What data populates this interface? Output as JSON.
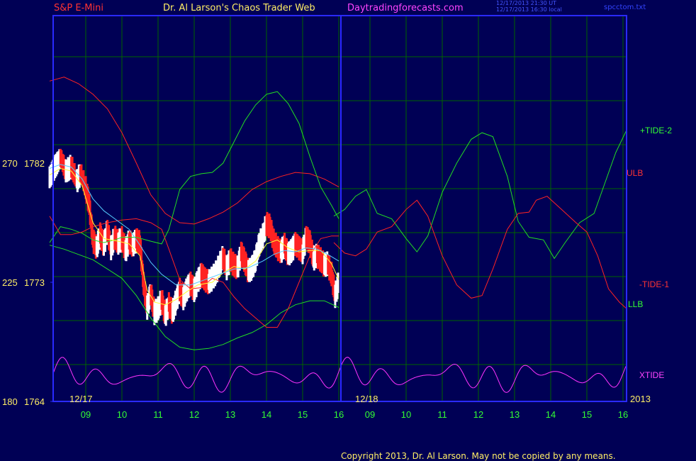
{
  "header": {
    "instrument": "S&P E-Mini",
    "title": "Dr. Al Larson's Chaos Trader Web",
    "site": "Daytradingforecasts.com",
    "stamp_line1": "12/17/2013 21:30 UT",
    "stamp_line2": "12/17/2013 16:30 local",
    "file": "spcctom.txt"
  },
  "footer": {
    "copyright": "Copyright 2013, Dr. Al Larson. May not be copied by any means."
  },
  "colors": {
    "background": "#000055",
    "frame": "#2a2aff",
    "grid": "#006400",
    "red": "#ff2222",
    "green": "#22dd22",
    "magenta": "#ff33ff",
    "white": "#ffffff",
    "yellow": "#ffff33",
    "cyan": "#55ccff",
    "axis_text": "#33ff33",
    "title_text": "#ffee66"
  },
  "chart_data": {
    "type": "line",
    "x_ticks": [
      "09",
      "10",
      "11",
      "12",
      "13",
      "14",
      "15",
      "16",
      "09",
      "10",
      "11",
      "12",
      "13",
      "14",
      "15",
      "16"
    ],
    "date_labels": [
      "12/17",
      "12/18",
      "2013"
    ],
    "y_ticks": [
      {
        "left": "270",
        "right": "1782",
        "value": 1782
      },
      {
        "left": "225",
        "right": "1773",
        "value": 1773
      },
      {
        "left": "180",
        "right": "1764",
        "value": 1764
      }
    ],
    "ylim": [
      1764,
      1790.6
    ],
    "xlim": [
      8,
      16.1
    ],
    "grid": true,
    "legend": [
      {
        "label": "+TIDE-2",
        "color": "#33ff33"
      },
      {
        "label": "ULB",
        "color": "#ff3333"
      },
      {
        "label": "-TIDE-1",
        "color": "#ff3333"
      },
      {
        "label": "LLB",
        "color": "#33ff33"
      },
      {
        "label": "XTIDE",
        "color": "#ff44ff"
      }
    ],
    "series": [
      {
        "name": "ULB",
        "color": "#ff2222",
        "day": 1,
        "points": [
          [
            8.0,
            1788.2
          ],
          [
            8.4,
            1788.5
          ],
          [
            8.8,
            1788.0
          ],
          [
            9.2,
            1787.2
          ],
          [
            9.6,
            1786.1
          ],
          [
            10.0,
            1784.3
          ],
          [
            10.4,
            1782.0
          ],
          [
            10.8,
            1779.6
          ],
          [
            11.2,
            1778.2
          ],
          [
            11.6,
            1777.5
          ],
          [
            12.0,
            1777.4
          ],
          [
            12.4,
            1777.8
          ],
          [
            12.8,
            1778.3
          ],
          [
            13.2,
            1779.0
          ],
          [
            13.6,
            1780.0
          ],
          [
            14.0,
            1780.6
          ],
          [
            14.4,
            1781.0
          ],
          [
            14.8,
            1781.3
          ],
          [
            15.2,
            1781.2
          ],
          [
            15.6,
            1780.8
          ],
          [
            16.0,
            1780.2
          ]
        ]
      },
      {
        "name": "LLB",
        "color": "#22dd22",
        "day": 1,
        "points": [
          [
            8.0,
            1775.8
          ],
          [
            8.4,
            1775.5
          ],
          [
            8.8,
            1775.1
          ],
          [
            9.2,
            1774.7
          ],
          [
            9.6,
            1774.0
          ],
          [
            10.0,
            1773.3
          ],
          [
            10.4,
            1772.0
          ],
          [
            10.8,
            1770.3
          ],
          [
            11.2,
            1768.9
          ],
          [
            11.6,
            1768.1
          ],
          [
            12.0,
            1767.9
          ],
          [
            12.4,
            1768.0
          ],
          [
            12.8,
            1768.3
          ],
          [
            13.2,
            1768.8
          ],
          [
            13.6,
            1769.2
          ],
          [
            14.0,
            1769.8
          ],
          [
            14.4,
            1770.7
          ],
          [
            14.8,
            1771.3
          ],
          [
            15.2,
            1771.6
          ],
          [
            15.6,
            1771.6
          ],
          [
            16.0,
            1771.1
          ]
        ]
      },
      {
        "name": "+TIDE-2",
        "color": "#22dd22",
        "day": 1,
        "points": [
          [
            8.0,
            1776.0
          ],
          [
            8.3,
            1777.2
          ],
          [
            8.6,
            1777.0
          ],
          [
            8.9,
            1776.7
          ],
          [
            9.2,
            1776.2
          ],
          [
            9.5,
            1776.0
          ],
          [
            9.8,
            1776.2
          ],
          [
            10.0,
            1776.4
          ],
          [
            10.4,
            1776.4
          ],
          [
            10.8,
            1776.1
          ],
          [
            11.1,
            1775.9
          ],
          [
            11.3,
            1777.0
          ],
          [
            11.6,
            1780.0
          ],
          [
            11.9,
            1781.0
          ],
          [
            12.2,
            1781.2
          ],
          [
            12.5,
            1781.3
          ],
          [
            12.8,
            1782.0
          ],
          [
            13.1,
            1783.6
          ],
          [
            13.4,
            1785.2
          ],
          [
            13.7,
            1786.4
          ],
          [
            14.0,
            1787.2
          ],
          [
            14.3,
            1787.4
          ],
          [
            14.6,
            1786.5
          ],
          [
            14.9,
            1785.0
          ],
          [
            15.2,
            1782.5
          ],
          [
            15.5,
            1780.2
          ],
          [
            15.8,
            1778.8
          ],
          [
            16.0,
            1777.8
          ]
        ]
      },
      {
        "name": "-TIDE-1",
        "color": "#ff2222",
        "day": 1,
        "points": [
          [
            8.0,
            1778.0
          ],
          [
            8.3,
            1776.6
          ],
          [
            8.6,
            1776.6
          ],
          [
            8.9,
            1776.8
          ],
          [
            9.2,
            1777.2
          ],
          [
            9.6,
            1777.5
          ],
          [
            10.0,
            1777.7
          ],
          [
            10.4,
            1777.8
          ],
          [
            10.8,
            1777.5
          ],
          [
            11.1,
            1777.0
          ],
          [
            11.3,
            1775.5
          ],
          [
            11.6,
            1773.2
          ],
          [
            11.9,
            1772.5
          ],
          [
            12.2,
            1772.6
          ],
          [
            12.5,
            1773.3
          ],
          [
            12.8,
            1773.0
          ],
          [
            13.1,
            1771.9
          ],
          [
            13.4,
            1771.0
          ],
          [
            13.7,
            1770.3
          ],
          [
            14.0,
            1769.6
          ],
          [
            14.3,
            1769.6
          ],
          [
            14.6,
            1771.0
          ],
          [
            14.9,
            1773.0
          ],
          [
            15.2,
            1775.0
          ],
          [
            15.5,
            1776.3
          ],
          [
            15.8,
            1776.5
          ],
          [
            16.0,
            1776.5
          ]
        ]
      },
      {
        "name": "+TIDE-2",
        "color": "#22dd22",
        "day": 2,
        "points": [
          [
            8.0,
            1778.0
          ],
          [
            8.3,
            1778.5
          ],
          [
            8.6,
            1779.5
          ],
          [
            8.9,
            1780.0
          ],
          [
            9.2,
            1778.2
          ],
          [
            9.6,
            1777.8
          ],
          [
            10.0,
            1776.3
          ],
          [
            10.3,
            1775.3
          ],
          [
            10.6,
            1776.5
          ],
          [
            11.0,
            1779.8
          ],
          [
            11.4,
            1782.0
          ],
          [
            11.8,
            1783.8
          ],
          [
            12.1,
            1784.3
          ],
          [
            12.4,
            1784.0
          ],
          [
            12.8,
            1781.0
          ],
          [
            13.1,
            1777.6
          ],
          [
            13.4,
            1776.4
          ],
          [
            13.8,
            1776.2
          ],
          [
            14.1,
            1774.8
          ],
          [
            14.4,
            1776.0
          ],
          [
            14.8,
            1777.5
          ],
          [
            15.2,
            1778.2
          ],
          [
            15.5,
            1780.5
          ],
          [
            15.8,
            1782.8
          ],
          [
            16.1,
            1784.5
          ]
        ]
      },
      {
        "name": "-TIDE-1",
        "color": "#ff2222",
        "day": 2,
        "points": [
          [
            8.0,
            1776.0
          ],
          [
            8.3,
            1775.2
          ],
          [
            8.6,
            1775.0
          ],
          [
            8.9,
            1775.5
          ],
          [
            9.2,
            1776.8
          ],
          [
            9.6,
            1777.2
          ],
          [
            10.0,
            1778.5
          ],
          [
            10.3,
            1779.2
          ],
          [
            10.6,
            1778.0
          ],
          [
            11.0,
            1775.0
          ],
          [
            11.4,
            1772.8
          ],
          [
            11.8,
            1771.8
          ],
          [
            12.1,
            1772.0
          ],
          [
            12.4,
            1774.0
          ],
          [
            12.8,
            1777.0
          ],
          [
            13.1,
            1778.2
          ],
          [
            13.4,
            1778.3
          ],
          [
            13.6,
            1779.2
          ],
          [
            13.9,
            1779.5
          ],
          [
            14.3,
            1778.5
          ],
          [
            14.7,
            1777.5
          ],
          [
            15.0,
            1776.8
          ],
          [
            15.3,
            1775.0
          ],
          [
            15.6,
            1772.5
          ],
          [
            15.9,
            1771.5
          ],
          [
            16.1,
            1771.0
          ]
        ]
      },
      {
        "name": "mavg-yellow",
        "color": "#ffff33",
        "day": 1,
        "points": [
          [
            8.0,
            1781.1
          ],
          [
            8.3,
            1781.6
          ],
          [
            8.6,
            1781.4
          ],
          [
            8.9,
            1780.3
          ],
          [
            9.2,
            1777.5
          ],
          [
            9.5,
            1776.3
          ],
          [
            9.9,
            1776.1
          ],
          [
            10.2,
            1775.9
          ],
          [
            10.5,
            1775.0
          ],
          [
            10.7,
            1772.4
          ],
          [
            10.9,
            1771.5
          ],
          [
            11.2,
            1771.3
          ],
          [
            11.5,
            1771.7
          ],
          [
            11.8,
            1772.3
          ],
          [
            12.1,
            1772.8
          ],
          [
            12.5,
            1773.0
          ],
          [
            12.8,
            1773.7
          ],
          [
            13.1,
            1774.2
          ],
          [
            13.4,
            1774.0
          ],
          [
            13.7,
            1774.6
          ],
          [
            14.0,
            1775.9
          ],
          [
            14.3,
            1776.2
          ],
          [
            14.6,
            1775.6
          ],
          [
            14.9,
            1775.3
          ],
          [
            15.2,
            1775.4
          ],
          [
            15.5,
            1775.4
          ],
          [
            15.8,
            1774.4
          ],
          [
            16.0,
            1773.2
          ]
        ]
      },
      {
        "name": "mavg-cyan",
        "color": "#55ccff",
        "day": 1,
        "points": [
          [
            8.0,
            1781.6
          ],
          [
            8.3,
            1781.9
          ],
          [
            8.6,
            1781.7
          ],
          [
            8.9,
            1780.8
          ],
          [
            9.2,
            1779.3
          ],
          [
            9.5,
            1778.4
          ],
          [
            9.8,
            1777.8
          ],
          [
            10.2,
            1777.0
          ],
          [
            10.5,
            1775.8
          ],
          [
            10.8,
            1774.5
          ],
          [
            11.1,
            1773.6
          ],
          [
            11.5,
            1772.8
          ],
          [
            11.9,
            1772.8
          ],
          [
            12.3,
            1773.2
          ],
          [
            12.7,
            1773.6
          ],
          [
            13.1,
            1774.0
          ],
          [
            13.5,
            1774.1
          ],
          [
            13.9,
            1774.6
          ],
          [
            14.2,
            1775.1
          ],
          [
            14.5,
            1775.4
          ],
          [
            14.8,
            1775.3
          ],
          [
            15.1,
            1775.6
          ],
          [
            15.4,
            1775.5
          ],
          [
            15.7,
            1775.1
          ],
          [
            16.0,
            1774.6
          ]
        ]
      }
    ],
    "price_path": [
      [
        8.0,
        1780.9
      ],
      [
        8.15,
        1781.8
      ],
      [
        8.3,
        1782.3
      ],
      [
        8.45,
        1781.4
      ],
      [
        8.6,
        1781.8
      ],
      [
        8.75,
        1780.6
      ],
      [
        8.85,
        1781.2
      ],
      [
        9.0,
        1780.1
      ],
      [
        9.1,
        1778.8
      ],
      [
        9.2,
        1776.2
      ],
      [
        9.3,
        1775.6
      ],
      [
        9.4,
        1776.6
      ],
      [
        9.5,
        1775.8
      ],
      [
        9.6,
        1776.9
      ],
      [
        9.7,
        1775.6
      ],
      [
        9.8,
        1776.4
      ],
      [
        9.9,
        1776.0
      ],
      [
        10.0,
        1776.3
      ],
      [
        10.1,
        1775.4
      ],
      [
        10.2,
        1776.1
      ],
      [
        10.3,
        1775.8
      ],
      [
        10.4,
        1776.2
      ],
      [
        10.5,
        1776.0
      ],
      [
        10.6,
        1772.9
      ],
      [
        10.7,
        1771.1
      ],
      [
        10.8,
        1772.2
      ],
      [
        10.9,
        1770.7
      ],
      [
        11.0,
        1771.0
      ],
      [
        11.1,
        1771.7
      ],
      [
        11.2,
        1770.5
      ],
      [
        11.3,
        1771.3
      ],
      [
        11.4,
        1770.7
      ],
      [
        11.5,
        1771.6
      ],
      [
        11.6,
        1772.4
      ],
      [
        11.7,
        1771.8
      ],
      [
        11.8,
        1772.5
      ],
      [
        11.9,
        1772.9
      ],
      [
        12.0,
        1772.4
      ],
      [
        12.1,
        1773.1
      ],
      [
        12.2,
        1773.6
      ],
      [
        12.3,
        1773.2
      ],
      [
        12.4,
        1773.0
      ],
      [
        12.5,
        1773.3
      ],
      [
        12.6,
        1773.7
      ],
      [
        12.7,
        1774.3
      ],
      [
        12.8,
        1774.9
      ],
      [
        12.9,
        1774.1
      ],
      [
        13.0,
        1774.7
      ],
      [
        13.1,
        1774.3
      ],
      [
        13.2,
        1774.1
      ],
      [
        13.3,
        1775.2
      ],
      [
        13.4,
        1774.6
      ],
      [
        13.5,
        1773.8
      ],
      [
        13.6,
        1774.1
      ],
      [
        13.7,
        1774.7
      ],
      [
        13.8,
        1775.9
      ],
      [
        13.9,
        1776.5
      ],
      [
        14.0,
        1777.4
      ],
      [
        14.1,
        1777.2
      ],
      [
        14.2,
        1776.1
      ],
      [
        14.3,
        1775.6
      ],
      [
        14.4,
        1775.3
      ],
      [
        14.5,
        1775.8
      ],
      [
        14.6,
        1775.1
      ],
      [
        14.7,
        1775.4
      ],
      [
        14.8,
        1775.9
      ],
      [
        14.9,
        1775.6
      ],
      [
        15.0,
        1775.3
      ],
      [
        15.1,
        1776.4
      ],
      [
        15.2,
        1776.0
      ],
      [
        15.3,
        1774.8
      ],
      [
        15.4,
        1775.0
      ],
      [
        15.5,
        1774.7
      ],
      [
        15.6,
        1774.3
      ],
      [
        15.7,
        1774.4
      ],
      [
        15.8,
        1773.6
      ],
      [
        15.9,
        1772.0
      ],
      [
        16.0,
        1773.0
      ]
    ]
  }
}
